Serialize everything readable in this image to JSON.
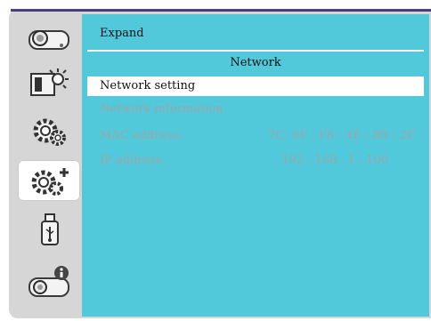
{
  "header": {
    "title": "Expand"
  },
  "section": {
    "title": "Network"
  },
  "menu": {
    "items": [
      {
        "label": "Network setting",
        "value": ""
      },
      {
        "label": "Network information",
        "value": ""
      },
      {
        "label": "MAC address:",
        "value": "7C: 6F : F8 : 4E : B9 : 2F"
      },
      {
        "label": "IP address",
        "value": "192 . 168 . 1 . 100"
      }
    ]
  },
  "sidebar": {
    "items": [
      {
        "icon": "camera-icon"
      },
      {
        "icon": "brightness-icon"
      },
      {
        "icon": "settings-gear-icon"
      },
      {
        "icon": "expand-settings-icon",
        "active": true
      },
      {
        "icon": "usb-icon"
      },
      {
        "icon": "info-icon"
      }
    ]
  },
  "colors": {
    "panel": "#52c9da",
    "frame": "#d6d6d6",
    "highlight": "#ffffff"
  }
}
